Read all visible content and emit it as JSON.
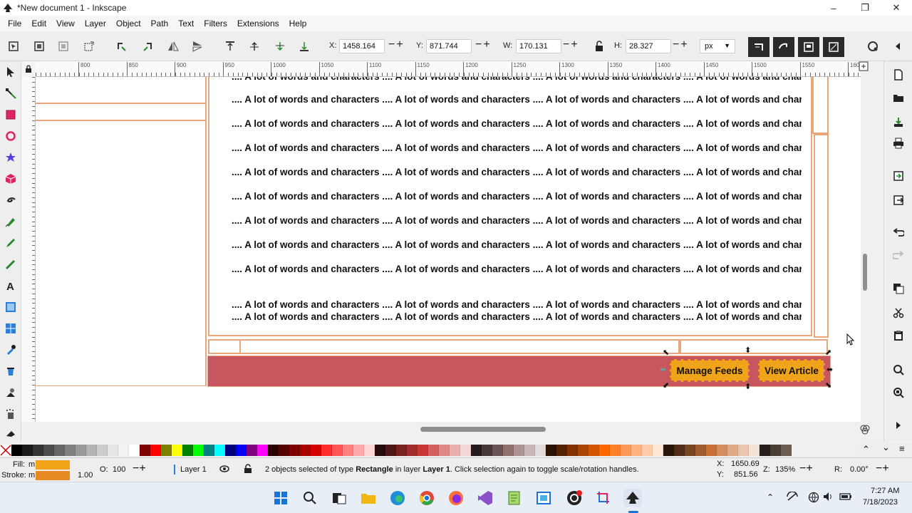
{
  "window": {
    "title": "*New document 1 - Inkscape",
    "controls": {
      "minimize": "–",
      "maximize": "❐",
      "close": "✕"
    }
  },
  "menu": [
    "File",
    "Edit",
    "View",
    "Layer",
    "Object",
    "Path",
    "Text",
    "Filters",
    "Extensions",
    "Help"
  ],
  "toolbar": {
    "x_label": "X:",
    "x_value": "1458.164",
    "y_label": "Y:",
    "y_value": "871.744",
    "w_label": "W:",
    "w_value": "170.131",
    "h_label": "H:",
    "h_value": "28.327",
    "unit": "px",
    "pm": "−+"
  },
  "ruler": {
    "labels": [
      "800",
      "850",
      "900",
      "950",
      "1000",
      "1050",
      "1100",
      "1150",
      "1200",
      "1250",
      "1300",
      "1350",
      "1400",
      "1450",
      "1500",
      "1550",
      "1600",
      "1650"
    ]
  },
  "canvas": {
    "text_line": ".... A lot of words and characters .... A lot of words and characters .... A lot of words and characters .... A lot of words and charac",
    "buttons": {
      "manage_feeds": "Manage Feeds",
      "view_article": "View Article"
    },
    "colors": {
      "bar": "#c8565e",
      "button_fill": "#f0a419",
      "outline": "#e7a77a"
    }
  },
  "status": {
    "fill_label": "Fill:",
    "fill_value": "m",
    "stroke_label": "Stroke:",
    "stroke_value": "m",
    "stroke_width": "1.00",
    "opacity_label": "O:",
    "opacity_value": "100",
    "layer": "Layer 1",
    "message_prefix": "2 objects selected of type ",
    "message_type": "Rectangle",
    "message_mid": " in layer ",
    "message_layer": "Layer 1",
    "message_suffix": ". Click selection again to toggle scale/rotation handles.",
    "cursor_x_label": "X:",
    "cursor_x": "1650.69",
    "cursor_y_label": "Y:",
    "cursor_y": "851.56",
    "zoom_label": "Z:",
    "zoom": "135%",
    "rotation_label": "R:",
    "rotation": "0.00°"
  },
  "palette": [
    "#000000",
    "#1a1a1a",
    "#333333",
    "#4d4d4d",
    "#666666",
    "#808080",
    "#999999",
    "#b3b3b3",
    "#cccccc",
    "#e6e6e6",
    "#f2f2f2",
    "#ffffff",
    "#800000",
    "#ff0000",
    "#808000",
    "#ffff00",
    "#008000",
    "#00ff00",
    "#008080",
    "#00ffff",
    "#000080",
    "#0000ff",
    "#800080",
    "#ff00ff",
    "#2b0000",
    "#550000",
    "#800000",
    "#aa0000",
    "#d40000",
    "#ff2a2a",
    "#ff5555",
    "#ff8080",
    "#ffaaaa",
    "#ffd5d5",
    "#280b0b",
    "#501616",
    "#782121",
    "#a02c2c",
    "#c83737",
    "#d35f5f",
    "#de8787",
    "#e9afaf",
    "#f4d7d7",
    "#241c1c",
    "#483737",
    "#6c5353",
    "#916f6f",
    "#ac9393",
    "#c8b7b7",
    "#e3dbdb",
    "#2b1100",
    "#552200",
    "#803300",
    "#aa4400",
    "#d45500",
    "#ff6600",
    "#ff7f2a",
    "#ff9955",
    "#ffb380",
    "#ffccaa",
    "#ffe6d5",
    "#28170b",
    "#502d16",
    "#784421",
    "#a05a2c",
    "#c87137",
    "#d38d5f",
    "#deaa87",
    "#e9c6af",
    "#f4e3d7",
    "#241f1c",
    "#483e37",
    "#6c5d53"
  ],
  "taskbar": {
    "time": "7:27 AM",
    "date": "7/18/2023"
  }
}
